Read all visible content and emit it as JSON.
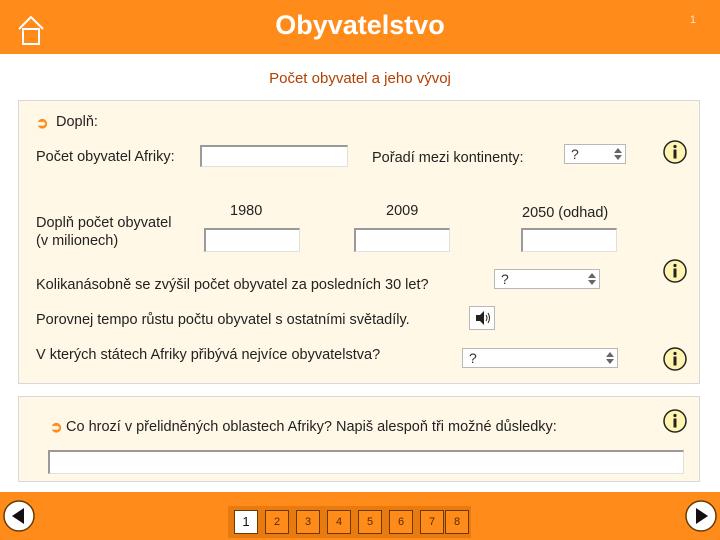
{
  "header": {
    "title": "Obyvatelstvo",
    "page_number": "1"
  },
  "subtitle": "Počet obyvatel a jeho vývoj",
  "panel1": {
    "instruction": "Doplň:",
    "population_africa_label": "Počet obyvatel Afriky:",
    "population_africa_value": "",
    "rank_label": "Pořadí mezi kontinenty:",
    "rank_value": "?",
    "fill_population_label_line1": "Doplň počet obyvatel",
    "fill_population_label_line2": "(v milionech)",
    "years": [
      {
        "label": "1980",
        "value": ""
      },
      {
        "label": "2009",
        "value": ""
      },
      {
        "label": "2050 (odhad)",
        "value": ""
      }
    ],
    "growth_question": "Kolikanásobně se zvýšil počet obyvatel za posledních 30 let?",
    "growth_value": "?",
    "compare_question": "Porovnej tempo růstu počtu obyvatel s ostatními světadíly.",
    "states_question": "V kterých státech Afriky přibývá nejvíce obyvatelstva?",
    "states_value": "?"
  },
  "panel2": {
    "question": "Co hrozí v přelidněných oblastech Afriky? Napiš alespoň tři možné důsledky:",
    "answer_value": ""
  },
  "footer": {
    "pages": [
      "1",
      "2",
      "3",
      "4",
      "5",
      "6",
      "7",
      "8"
    ],
    "active_page": "1"
  },
  "colors": {
    "accent": "#ff8c1a",
    "panel_bg": "#fff8e7",
    "info_icon_fill": "#fff5b0"
  }
}
